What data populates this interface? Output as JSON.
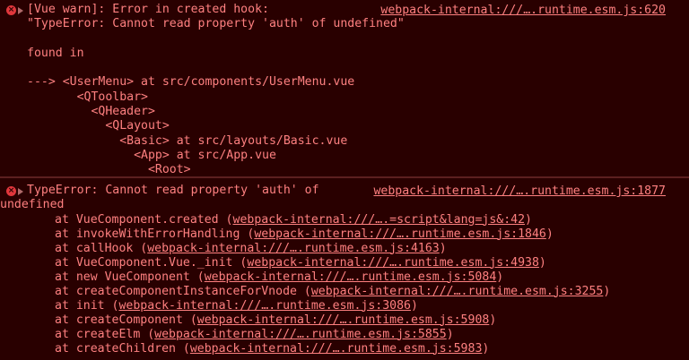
{
  "entry1": {
    "message": "[Vue warn]: Error in created hook:",
    "source": "webpack-internal:///….runtime.esm.js:620",
    "lines": [
      "\"TypeError: Cannot read property 'auth' of undefined\"",
      "",
      "found in",
      "",
      "---> <UserMenu> at src/components/UserMenu.vue",
      "       <QToolbar>",
      "         <QHeader>",
      "           <QLayout>",
      "             <Basic> at src/layouts/Basic.vue",
      "               <App> at src/App.vue",
      "                 <Root>"
    ]
  },
  "entry2": {
    "message": "TypeError: Cannot read property 'auth' of",
    "message_cont": "undefined",
    "source": "webpack-internal:///….runtime.esm.js:1877",
    "frames": [
      {
        "prefix": "at VueComponent.created (",
        "link": "webpack-internal:///….=script&lang=js&:42",
        "suffix": ")"
      },
      {
        "prefix": "at invokeWithErrorHandling (",
        "link": "webpack-internal:///….runtime.esm.js:1846",
        "suffix": ")"
      },
      {
        "prefix": "at callHook (",
        "link": "webpack-internal:///….runtime.esm.js:4163",
        "suffix": ")"
      },
      {
        "prefix": "at VueComponent.Vue._init (",
        "link": "webpack-internal:///….runtime.esm.js:4938",
        "suffix": ")"
      },
      {
        "prefix": "at new VueComponent (",
        "link": "webpack-internal:///….runtime.esm.js:5084",
        "suffix": ")"
      },
      {
        "prefix": "at createComponentInstanceForVnode (",
        "link": "webpack-internal:///….runtime.esm.js:3255",
        "suffix": ")"
      },
      {
        "prefix": "at init (",
        "link": "webpack-internal:///….runtime.esm.js:3086",
        "suffix": ")"
      },
      {
        "prefix": "at createComponent (",
        "link": "webpack-internal:///….runtime.esm.js:5908",
        "suffix": ")"
      },
      {
        "prefix": "at createElm (",
        "link": "webpack-internal:///….runtime.esm.js:5855",
        "suffix": ")"
      },
      {
        "prefix": "at createChildren (",
        "link": "webpack-internal:///….runtime.esm.js:5983",
        "suffix": ")"
      }
    ]
  },
  "icons": {
    "error": "error-circle-icon",
    "expand": "expand-triangle-icon"
  },
  "colors": {
    "background": "#290000",
    "text": "#fe8080",
    "icon": "#e0373c"
  }
}
